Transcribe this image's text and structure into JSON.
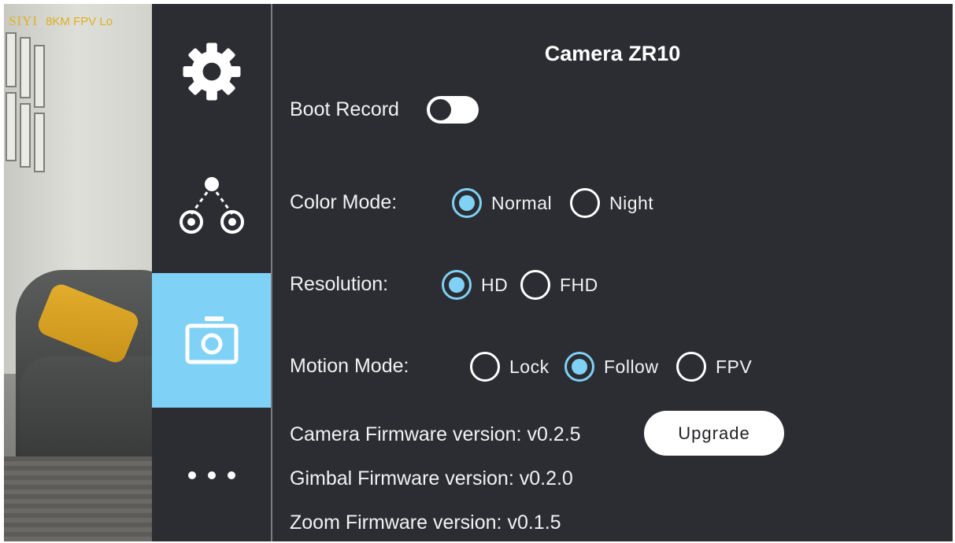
{
  "feed": {
    "osd_brand": "SIYI",
    "osd_text": "8KM FPV Lo"
  },
  "nav": {
    "items": [
      {
        "icon": "gear-icon",
        "active": false
      },
      {
        "icon": "gimbal-icon",
        "active": false
      },
      {
        "icon": "camera-icon",
        "active": true
      },
      {
        "icon": "more-icon",
        "active": false
      }
    ],
    "active_color": "#7fd1f5"
  },
  "panel": {
    "title": "Camera ZR10",
    "boot_record": {
      "label": "Boot Record",
      "on": false
    },
    "color_mode": {
      "label": "Color Mode:",
      "options": [
        "Normal",
        "Night"
      ],
      "selected": "Normal"
    },
    "resolution": {
      "label": "Resolution:",
      "options": [
        "HD",
        "FHD"
      ],
      "selected": "HD"
    },
    "motion_mode": {
      "label": "Motion Mode:",
      "options": [
        "Lock",
        "Follow",
        "FPV"
      ],
      "selected": "Follow"
    },
    "camera_firmware": "Camera Firmware version: v0.2.5",
    "upgrade_label": "Upgrade",
    "gimbal_firmware": "Gimbal Firmware version: v0.2.0",
    "zoom_firmware": "Zoom Firmware version: v0.1.5"
  },
  "colors": {
    "background": "#2b2d33",
    "accent": "#7fd1f5",
    "osd": "#e0b020"
  }
}
